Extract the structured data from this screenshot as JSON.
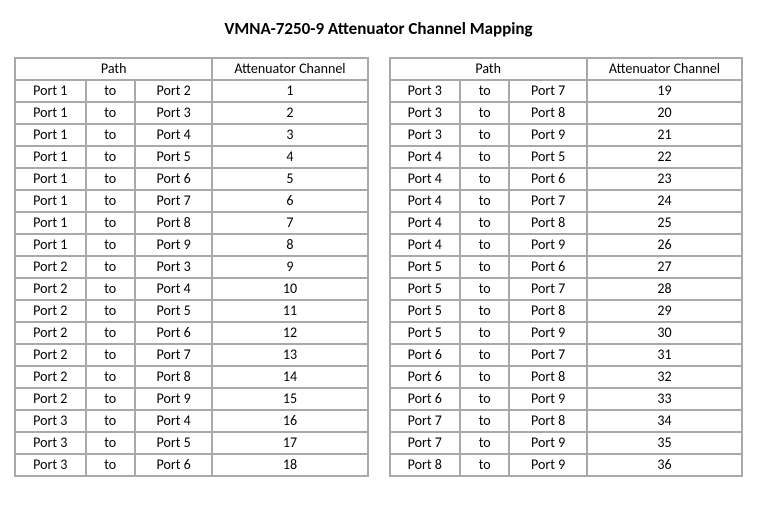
{
  "title": "VMNA-7250-9 Attenuator Channel Mapping",
  "headers": {
    "path": "Path",
    "channel": "Attenuator Channel"
  },
  "left": [
    {
      "from": "Port 1",
      "to": "to",
      "dest": "Port 2",
      "chan": "1"
    },
    {
      "from": "Port 1",
      "to": "to",
      "dest": "Port 3",
      "chan": "2"
    },
    {
      "from": "Port 1",
      "to": "to",
      "dest": "Port 4",
      "chan": "3"
    },
    {
      "from": "Port 1",
      "to": "to",
      "dest": "Port 5",
      "chan": "4"
    },
    {
      "from": "Port 1",
      "to": "to",
      "dest": "Port 6",
      "chan": "5"
    },
    {
      "from": "Port 1",
      "to": "to",
      "dest": "Port 7",
      "chan": "6"
    },
    {
      "from": "Port 1",
      "to": "to",
      "dest": "Port 8",
      "chan": "7"
    },
    {
      "from": "Port 1",
      "to": "to",
      "dest": "Port 9",
      "chan": "8"
    },
    {
      "from": "Port 2",
      "to": "to",
      "dest": "Port 3",
      "chan": "9"
    },
    {
      "from": "Port 2",
      "to": "to",
      "dest": "Port 4",
      "chan": "10"
    },
    {
      "from": "Port 2",
      "to": "to",
      "dest": "Port 5",
      "chan": "11"
    },
    {
      "from": "Port 2",
      "to": "to",
      "dest": "Port 6",
      "chan": "12"
    },
    {
      "from": "Port 2",
      "to": "to",
      "dest": "Port 7",
      "chan": "13"
    },
    {
      "from": "Port 2",
      "to": "to",
      "dest": "Port 8",
      "chan": "14"
    },
    {
      "from": "Port 2",
      "to": "to",
      "dest": "Port 9",
      "chan": "15"
    },
    {
      "from": "Port 3",
      "to": "to",
      "dest": "Port 4",
      "chan": "16"
    },
    {
      "from": "Port 3",
      "to": "to",
      "dest": "Port 5",
      "chan": "17"
    },
    {
      "from": "Port 3",
      "to": "to",
      "dest": "Port 6",
      "chan": "18"
    }
  ],
  "right": [
    {
      "from": "Port 3",
      "to": "to",
      "dest": "Port 7",
      "chan": "19"
    },
    {
      "from": "Port 3",
      "to": "to",
      "dest": "Port 8",
      "chan": "20"
    },
    {
      "from": "Port 3",
      "to": "to",
      "dest": "Port 9",
      "chan": "21"
    },
    {
      "from": "Port 4",
      "to": "to",
      "dest": "Port 5",
      "chan": "22"
    },
    {
      "from": "Port 4",
      "to": "to",
      "dest": "Port 6",
      "chan": "23"
    },
    {
      "from": "Port 4",
      "to": "to",
      "dest": "Port 7",
      "chan": "24"
    },
    {
      "from": "Port 4",
      "to": "to",
      "dest": "Port 8",
      "chan": "25"
    },
    {
      "from": "Port 4",
      "to": "to",
      "dest": "Port 9",
      "chan": "26"
    },
    {
      "from": "Port 5",
      "to": "to",
      "dest": "Port 6",
      "chan": "27"
    },
    {
      "from": "Port 5",
      "to": "to",
      "dest": "Port 7",
      "chan": "28"
    },
    {
      "from": "Port 5",
      "to": "to",
      "dest": "Port 8",
      "chan": "29"
    },
    {
      "from": "Port 5",
      "to": "to",
      "dest": "Port 9",
      "chan": "30"
    },
    {
      "from": "Port 6",
      "to": "to",
      "dest": "Port 7",
      "chan": "31"
    },
    {
      "from": "Port 6",
      "to": "to",
      "dest": "Port 8",
      "chan": "32"
    },
    {
      "from": "Port 6",
      "to": "to",
      "dest": "Port 9",
      "chan": "33"
    },
    {
      "from": "Port 7",
      "to": "to",
      "dest": "Port 8",
      "chan": "34"
    },
    {
      "from": "Port 7",
      "to": "to",
      "dest": "Port 9",
      "chan": "35"
    },
    {
      "from": "Port 8",
      "to": "to",
      "dest": "Port 9",
      "chan": "36"
    }
  ]
}
